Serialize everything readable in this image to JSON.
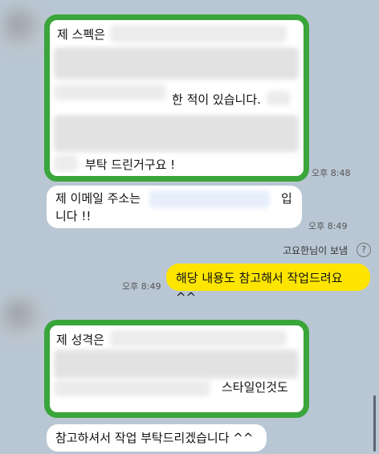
{
  "messages": {
    "m1": {
      "line1": "제 스펙은",
      "line2": "한 적이 있습니다.",
      "line3": "부탁 드린거구요 !",
      "time": "오후 8:48"
    },
    "m2": {
      "line1_a": "제 이메일 주소는",
      "line1_b": "입",
      "line2": "니다 !!",
      "time": "오후 8:49"
    },
    "sent": {
      "sender": "고요한님이 보냄",
      "help_icon": "question-circle-icon",
      "text": "해당 내용도 참고해서 작업드려요^^",
      "time": "오후 8:49"
    },
    "m3": {
      "line1": "제 성격은",
      "line2": "스타일인것도"
    },
    "m4": {
      "text": "참고하셔서 작업 부탁드리겠습니다 ^^"
    }
  },
  "colors": {
    "background": "#b9c6d3",
    "highlight_border": "#3aa53a",
    "my_bubble": "#fee500"
  }
}
